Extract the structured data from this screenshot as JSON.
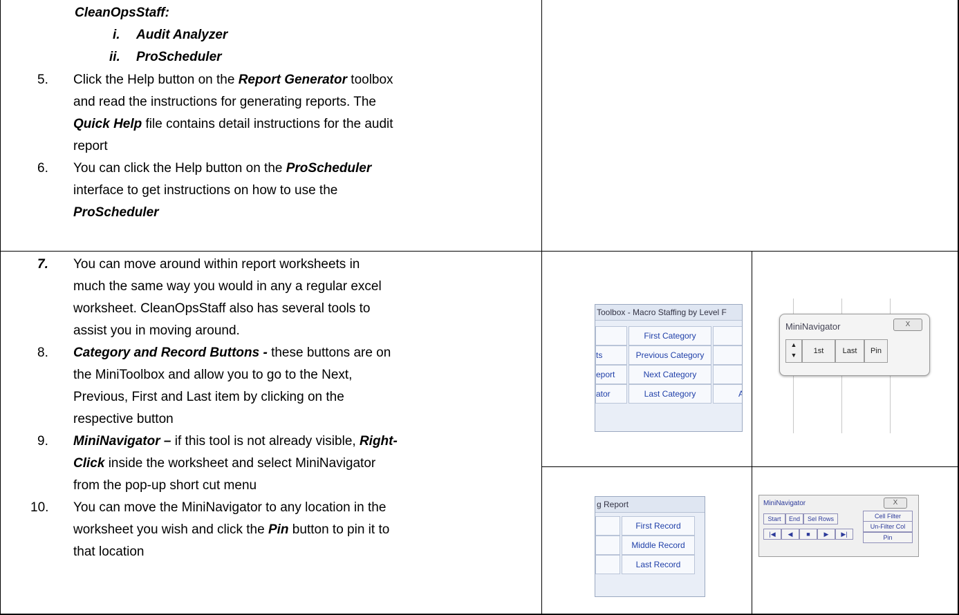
{
  "intro": {
    "heading": "CleanOpsStaff:",
    "sub_items": [
      {
        "marker": "i.",
        "text": "Audit Analyzer"
      },
      {
        "marker": "ii.",
        "text": "ProScheduler"
      }
    ]
  },
  "step5": {
    "num": "5.",
    "l1_a": "Click the Help button on the ",
    "l1_b": "Report Generator",
    "l1_c": " toolbox",
    "l2": "and read the instructions for generating reports.  The",
    "l3_a": "Quick Help",
    "l3_b": " file contains detail instructions for the audit",
    "l4": "report"
  },
  "step6": {
    "num": "6.",
    "l1_a": "You can click the Help button on the ",
    "l1_b": "ProScheduler",
    "l2": "interface to get instructions on how to use the",
    "l3": "ProScheduler"
  },
  "step7": {
    "num": "7.",
    "l1": "You can move around within report worksheets in",
    "l2": "much the same way you would in any a regular excel",
    "l3": "worksheet.  CleanOpsStaff also has several tools to",
    "l4": "assist you in moving around."
  },
  "step8": {
    "num": "8.",
    "l1_a": "Category and Record Buttons - ",
    "l1_b": " these buttons are on",
    "l2": "the MiniToolbox and allow you to go to the Next,",
    "l3": "Previous, First and Last item by clicking on the",
    "l4": "respective button"
  },
  "step9": {
    "num": "9.",
    "l1_a": "MiniNavigator –",
    "l1_b": " if this tool is not already visible, ",
    "l1_c": "Right-",
    "l2_a": "Click",
    "l2_b": " inside the worksheet and select MiniNavigator",
    "l3": "from the pop-up  short cut menu"
  },
  "step10": {
    "num": "10.",
    "l1": "You can move the MiniNavigator to any location in the",
    "l2_a": "worksheet you wish and click the ",
    "l2_b": "Pin",
    "l2_c": " button to pin it to",
    "l3": "that location"
  },
  "shot_category": {
    "title": "Toolbox - Macro Staffing by Level F",
    "left_cells": [
      "",
      "ts",
      "eport",
      "ator"
    ],
    "buttons": [
      "First Category",
      "Previous Category",
      "Next Category",
      "Last Category"
    ],
    "right_stub": "A"
  },
  "shot_mini1": {
    "title": "MiniNavigator",
    "close": "X",
    "buttons": [
      "1st",
      "Last",
      "Pin"
    ]
  },
  "shot_record": {
    "title": "g Report",
    "buttons": [
      "First Record",
      "Middle Record",
      "Last Record"
    ]
  },
  "shot_mini2": {
    "title": "MiniNavigator",
    "close": "X",
    "row1": [
      "Start",
      "End",
      "Sel Rows"
    ],
    "right": [
      "Cell Filter",
      "Un-Filter Col",
      "Pin"
    ],
    "nav": [
      "|◀",
      "◀",
      "■",
      "▶",
      "▶|"
    ]
  }
}
